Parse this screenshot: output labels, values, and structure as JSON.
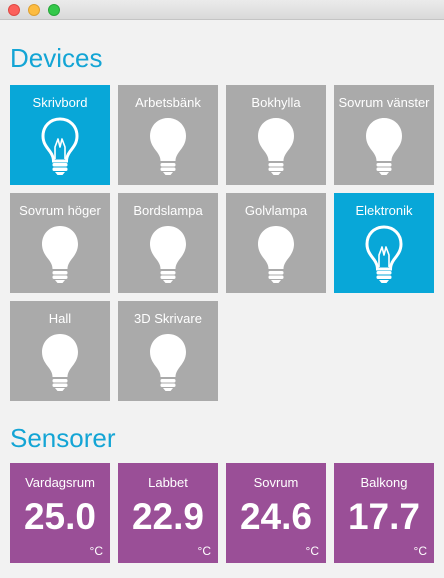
{
  "devices": {
    "title": "Devices",
    "items": [
      {
        "label": "Skrivbord",
        "state": "on",
        "icon": "lightbulb-icon"
      },
      {
        "label": "Arbetsbänk",
        "state": "off",
        "icon": "lightbulb-icon"
      },
      {
        "label": "Bokhylla",
        "state": "off",
        "icon": "lightbulb-icon"
      },
      {
        "label": "Sovrum vänster",
        "state": "off",
        "icon": "lightbulb-icon"
      },
      {
        "label": "Sovrum höger",
        "state": "off",
        "icon": "lightbulb-icon"
      },
      {
        "label": "Bordslampa",
        "state": "off",
        "icon": "lightbulb-icon"
      },
      {
        "label": "Golvlampa",
        "state": "off",
        "icon": "lightbulb-icon"
      },
      {
        "label": "Elektronik",
        "state": "on",
        "icon": "lightbulb-icon"
      },
      {
        "label": "Hall",
        "state": "off",
        "icon": "lightbulb-icon"
      },
      {
        "label": "3D Skrivare",
        "state": "off",
        "icon": "lightbulb-icon"
      }
    ]
  },
  "sensors": {
    "title": "Sensorer",
    "items": [
      {
        "label": "Vardagsrum",
        "value": "25.0",
        "unit": "°C"
      },
      {
        "label": "Labbet",
        "value": "22.9",
        "unit": "°C"
      },
      {
        "label": "Sovrum",
        "value": "24.6",
        "unit": "°C"
      },
      {
        "label": "Balkong",
        "value": "17.7",
        "unit": "°C"
      }
    ]
  },
  "colors": {
    "accent": "#14a5d5",
    "device_on": "#08a7d8",
    "device_off": "#aaaaaa",
    "sensor": "#9a4f97"
  }
}
